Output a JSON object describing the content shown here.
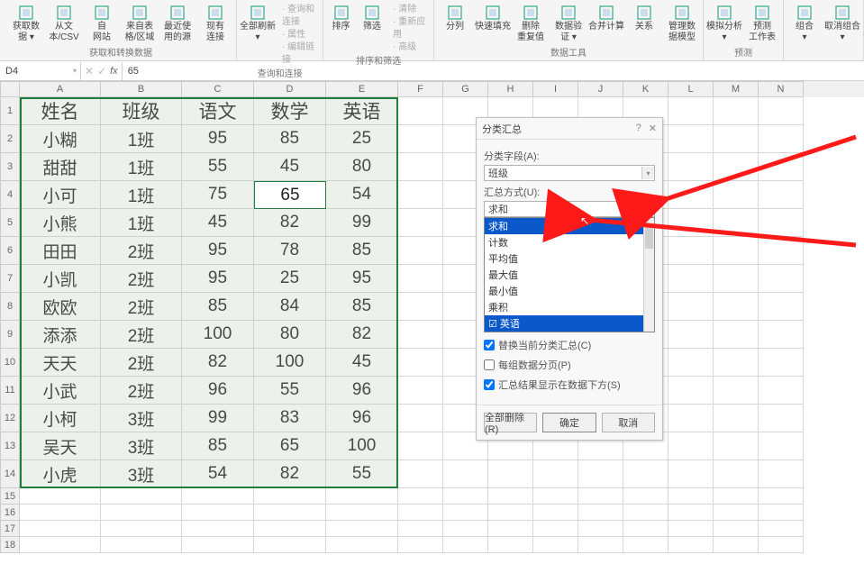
{
  "ribbon": {
    "groups": [
      {
        "label": "获取和转换数据",
        "items": [
          {
            "k": "get_data",
            "t": "获取数\n据 ▾"
          },
          {
            "k": "from_csv",
            "t": "从文\n本/CSV"
          },
          {
            "k": "from_web",
            "t": "自\n网站"
          },
          {
            "k": "from_range",
            "t": "来自表\n格/区域"
          },
          {
            "k": "recent",
            "t": "最近使\n用的源"
          },
          {
            "k": "existing",
            "t": "现有\n连接"
          }
        ]
      },
      {
        "label": "查询和连接",
        "items": [
          {
            "k": "refresh",
            "t": "全部刷新\n▾"
          }
        ],
        "side": [
          "查询和连接",
          "属性",
          "编辑链接"
        ]
      },
      {
        "label": "排序和筛选",
        "items": [
          {
            "k": "sort",
            "t": "排序"
          },
          {
            "k": "filter",
            "t": "筛选"
          }
        ],
        "side": [
          "清除",
          "重新应用",
          "高级"
        ]
      },
      {
        "label": "数据工具",
        "items": [
          {
            "k": "text_cols",
            "t": "分列"
          },
          {
            "k": "flash",
            "t": "快速填充"
          },
          {
            "k": "remove_dup",
            "t": "删除\n重复值"
          },
          {
            "k": "datavalid",
            "t": "数据验\n证 ▾"
          },
          {
            "k": "consolidate",
            "t": "合并计算"
          },
          {
            "k": "relations",
            "t": "关系"
          },
          {
            "k": "manage_dm",
            "t": "管理数\n据模型"
          }
        ]
      },
      {
        "label": "预测",
        "items": [
          {
            "k": "whatif",
            "t": "模拟分析\n▾"
          },
          {
            "k": "forecast",
            "t": "预测\n工作表"
          }
        ]
      },
      {
        "label": "",
        "items": [
          {
            "k": "group",
            "t": "组合\n▾"
          },
          {
            "k": "ungroup",
            "t": "取消组合\n▾"
          }
        ]
      }
    ]
  },
  "nameBox": "D4",
  "formula": "65",
  "columns": [
    "A",
    "B",
    "C",
    "D",
    "E",
    "F",
    "G",
    "H",
    "I",
    "J",
    "K",
    "L",
    "M",
    "N"
  ],
  "headerRow": [
    "姓名",
    "班级",
    "语文",
    "数学",
    "英语"
  ],
  "rows": [
    {
      "n": "小糊",
      "c": "1班",
      "yw": "95",
      "sx": "85",
      "yy": "25"
    },
    {
      "n": "甜甜",
      "c": "1班",
      "yw": "55",
      "sx": "45",
      "yy": "80"
    },
    {
      "n": "小可",
      "c": "1班",
      "yw": "75",
      "sx": "65",
      "yy": "54"
    },
    {
      "n": "小熊",
      "c": "1班",
      "yw": "45",
      "sx": "82",
      "yy": "99"
    },
    {
      "n": "田田",
      "c": "2班",
      "yw": "95",
      "sx": "78",
      "yy": "85"
    },
    {
      "n": "小凯",
      "c": "2班",
      "yw": "95",
      "sx": "25",
      "yy": "95"
    },
    {
      "n": "欧欧",
      "c": "2班",
      "yw": "85",
      "sx": "84",
      "yy": "85"
    },
    {
      "n": "添添",
      "c": "2班",
      "yw": "100",
      "sx": "80",
      "yy": "82"
    },
    {
      "n": "天天",
      "c": "2班",
      "yw": "82",
      "sx": "100",
      "yy": "45"
    },
    {
      "n": "小武",
      "c": "2班",
      "yw": "96",
      "sx": "55",
      "yy": "96"
    },
    {
      "n": "小柯",
      "c": "3班",
      "yw": "99",
      "sx": "83",
      "yy": "96"
    },
    {
      "n": "吴天",
      "c": "3班",
      "yw": "85",
      "sx": "65",
      "yy": "100"
    },
    {
      "n": "小虎",
      "c": "3班",
      "yw": "54",
      "sx": "82",
      "yy": "55"
    }
  ],
  "dialog": {
    "title": "分类汇总",
    "field_label": "分类字段(A):",
    "field_value": "班级",
    "method_label": "汇总方式(U):",
    "method_value": "求和",
    "options": [
      "求和",
      "计数",
      "平均值",
      "最大值",
      "最小值",
      "乘积"
    ],
    "hl_extra": "☑ 英语",
    "chk1": "替换当前分类汇总(C)",
    "chk2": "每组数据分页(P)",
    "chk3": "汇总结果显示在数据下方(S)",
    "btn_remove": "全部删除(R)",
    "btn_ok": "确定",
    "btn_cancel": "取消"
  }
}
